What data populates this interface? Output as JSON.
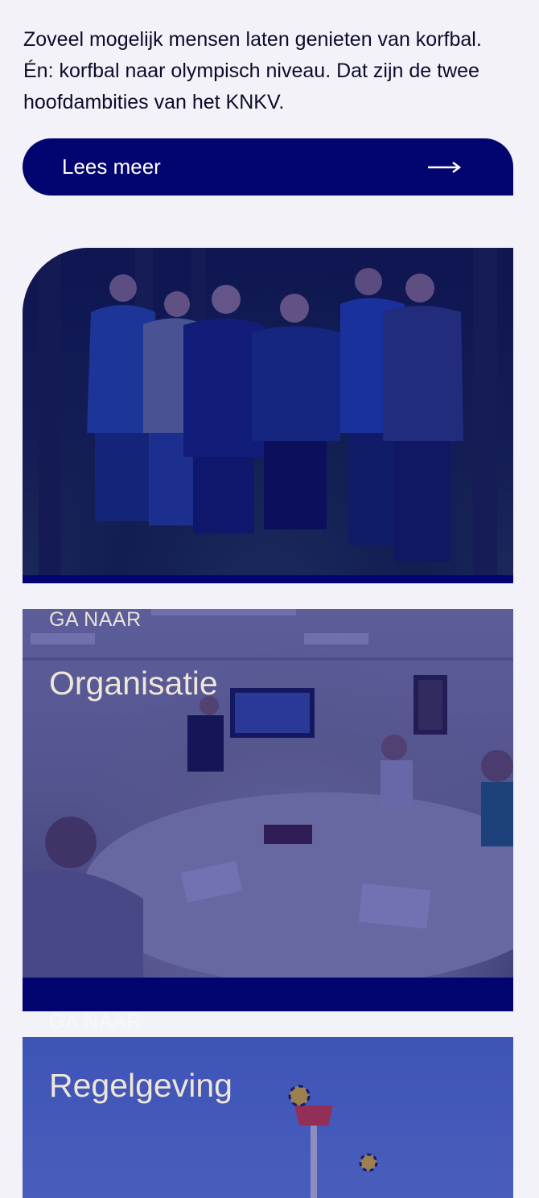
{
  "intro": {
    "text": "Zoveel mogelijk mensen laten genieten van korfbal. Én: korfbal naar olympisch niveau. Dat zijn de twee hoofdambities van het KNKV."
  },
  "read_more": {
    "label": "Lees meer",
    "icon": "arrow-right-icon"
  },
  "cards": [
    {
      "eyebrow": "",
      "title": ""
    },
    {
      "eyebrow": "GA NAAR",
      "title": "Organisatie"
    },
    {
      "eyebrow": "GA NAAR",
      "title": "Regelgeving"
    }
  ],
  "colors": {
    "brand": "#020570",
    "background": "#f3f2f9"
  }
}
